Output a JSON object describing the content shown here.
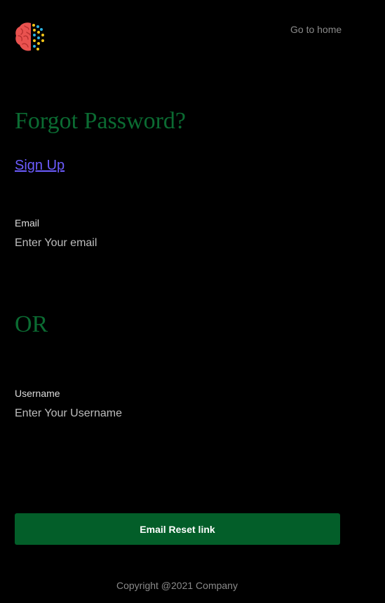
{
  "header": {
    "logo_icon": "brain-icon",
    "home_link": "Go to home"
  },
  "main": {
    "title": "Forgot Password?",
    "signup_link": "Sign Up",
    "email": {
      "label": "Email",
      "placeholder": "Enter Your email",
      "value": ""
    },
    "separator": "OR",
    "username": {
      "label": "Username",
      "placeholder": "Enter Your Username",
      "value": ""
    },
    "submit_label": "Email Reset link"
  },
  "footer": {
    "copyright": "Copyright @2021 Company"
  },
  "colors": {
    "background": "#000000",
    "heading": "#0b6b32",
    "button": "#035e29",
    "link": "#6c5cff"
  }
}
